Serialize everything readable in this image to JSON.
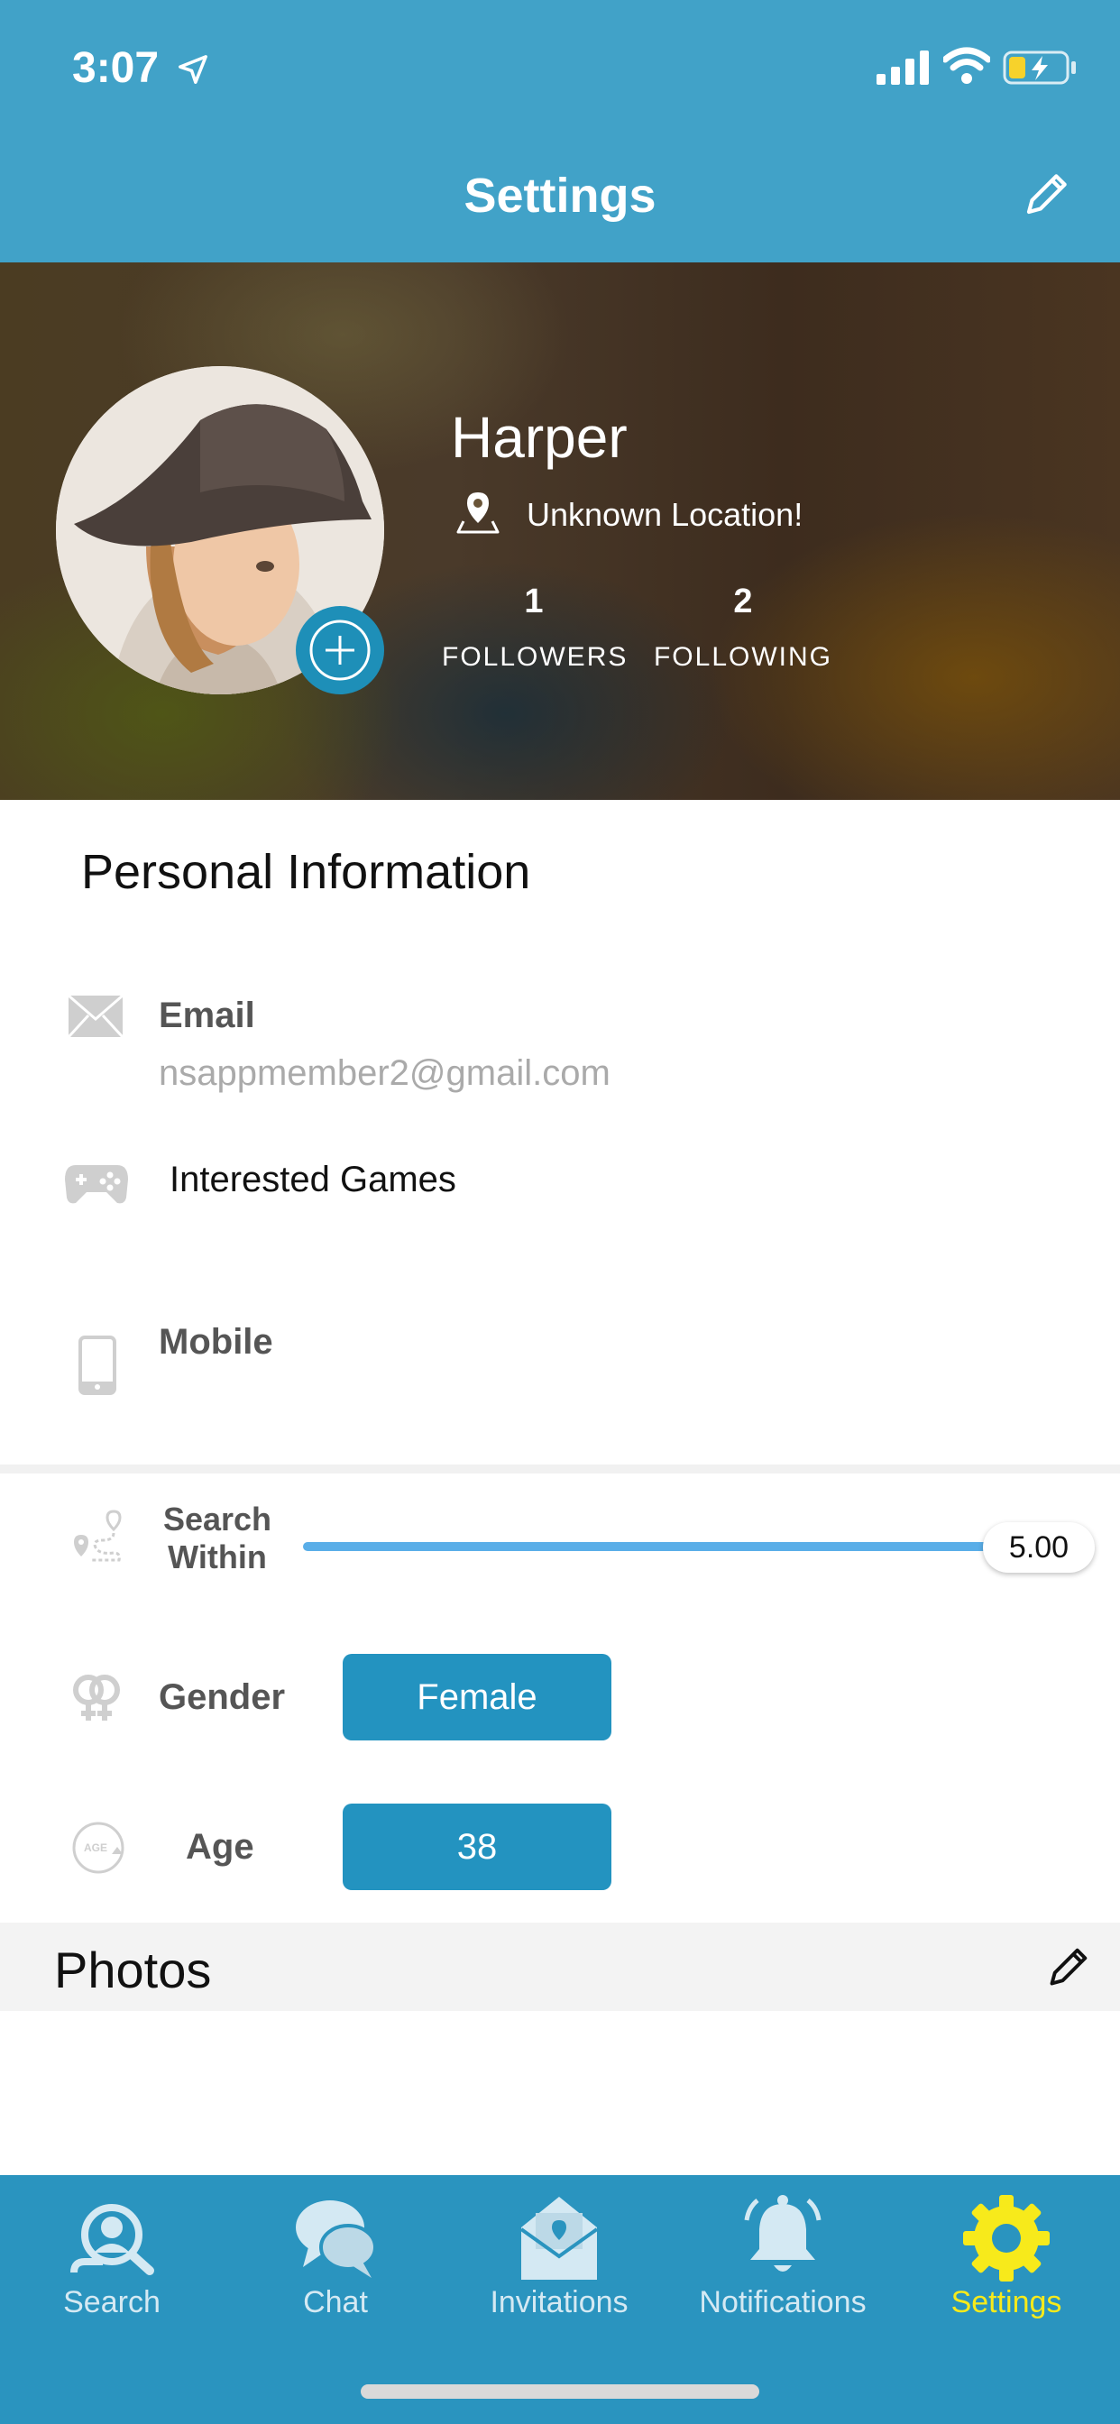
{
  "status": {
    "time": "3:07"
  },
  "header": {
    "title": "Settings"
  },
  "profile": {
    "name": "Harper",
    "location": "Unknown Location!",
    "followers_count": "1",
    "followers_label": "FOLLOWERS",
    "following_count": "2",
    "following_label": "FOLLOWING"
  },
  "personal": {
    "title": "Personal Information",
    "email_label": "Email",
    "email_value": "nsappmember2@gmail.com",
    "games_label": "Interested Games",
    "mobile_label": "Mobile"
  },
  "preferences": {
    "search_label_1": "Search",
    "search_label_2": "Within",
    "search_value": "5.00",
    "search_fraction": 1.0,
    "gender_label": "Gender",
    "gender_value": "Female",
    "age_label": "Age",
    "age_value": "38",
    "age_icon_text": "AGE"
  },
  "photos": {
    "title": "Photos"
  },
  "tabs": [
    {
      "label": "Search",
      "icon": "search-user-icon"
    },
    {
      "label": "Chat",
      "icon": "chat-icon"
    },
    {
      "label": "Invitations",
      "icon": "invitation-icon"
    },
    {
      "label": "Notifications",
      "icon": "bell-icon"
    },
    {
      "label": "Settings",
      "icon": "gear-icon",
      "active": true
    }
  ],
  "colors": {
    "header": "#41A2C8",
    "tabbar": "#2A94BF",
    "active_tab": "#F7EA1B",
    "pill": "#2393C0",
    "slider": "#5AAEE8"
  }
}
